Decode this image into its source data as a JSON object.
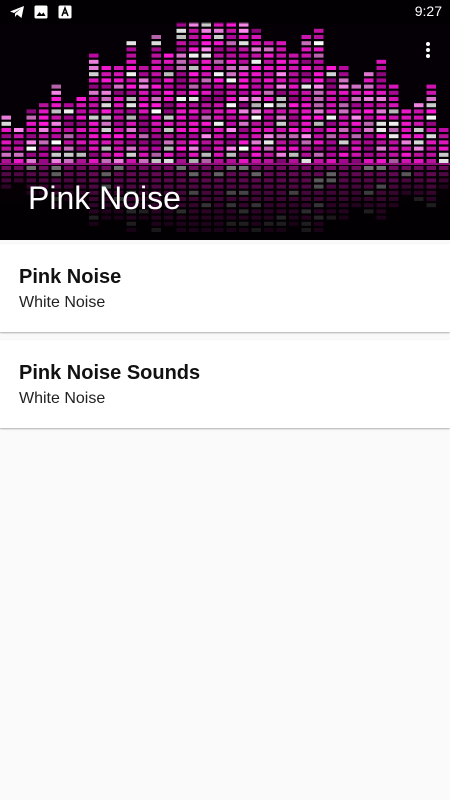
{
  "status_bar": {
    "time": "9:27",
    "icons": [
      "telegram-icon",
      "image-icon",
      "font-icon"
    ]
  },
  "header": {
    "title": "Pink Noise",
    "accent_color": "#ff1ad9",
    "overflow_icon": "more-vert-icon"
  },
  "items": [
    {
      "title": "Pink Noise",
      "subtitle": "White Noise"
    },
    {
      "title": "Pink Noise Sounds",
      "subtitle": "White Noise"
    }
  ]
}
